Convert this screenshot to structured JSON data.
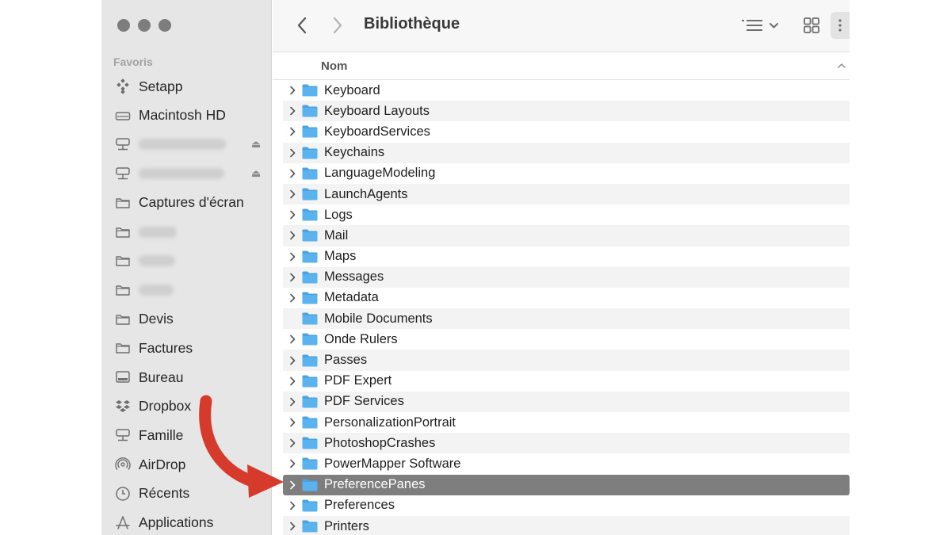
{
  "window": {
    "title": "Bibliothèque"
  },
  "sidebar": {
    "section_label": "Favoris",
    "items": [
      {
        "label": "Setapp",
        "icon": "setapp-icon"
      },
      {
        "label": "Macintosh HD",
        "icon": "hard-drive-icon"
      },
      {
        "label": "",
        "icon": "network-drive-icon",
        "blurred": true,
        "eject": "⏏"
      },
      {
        "label": "",
        "icon": "network-drive-icon",
        "blurred": true,
        "eject": "⏏"
      },
      {
        "label": "Captures d'écran",
        "icon": "folder-icon"
      },
      {
        "label": "",
        "icon": "folder-icon",
        "blurred": true
      },
      {
        "label": "",
        "icon": "folder-icon",
        "blurred": true
      },
      {
        "label": "",
        "icon": "folder-icon",
        "blurred": true
      },
      {
        "label": "Devis",
        "icon": "folder-icon"
      },
      {
        "label": "Factures",
        "icon": "folder-icon"
      },
      {
        "label": "Bureau",
        "icon": "desktop-icon"
      },
      {
        "label": "Dropbox",
        "icon": "dropbox-icon"
      },
      {
        "label": "Famille",
        "icon": "network-drive-icon"
      },
      {
        "label": "AirDrop",
        "icon": "airdrop-icon"
      },
      {
        "label": "Récents",
        "icon": "clock-icon"
      },
      {
        "label": "Applications",
        "icon": "applications-icon"
      }
    ]
  },
  "list": {
    "column_name": "Nom",
    "rows": [
      {
        "name": "Keyboard",
        "expandable": true
      },
      {
        "name": "Keyboard Layouts",
        "expandable": true
      },
      {
        "name": "KeyboardServices",
        "expandable": true
      },
      {
        "name": "Keychains",
        "expandable": true
      },
      {
        "name": "LanguageModeling",
        "expandable": true
      },
      {
        "name": "LaunchAgents",
        "expandable": true
      },
      {
        "name": "Logs",
        "expandable": true
      },
      {
        "name": "Mail",
        "expandable": true
      },
      {
        "name": "Maps",
        "expandable": true
      },
      {
        "name": "Messages",
        "expandable": true
      },
      {
        "name": "Metadata",
        "expandable": true
      },
      {
        "name": "Mobile Documents",
        "expandable": false
      },
      {
        "name": "Onde Rulers",
        "expandable": true
      },
      {
        "name": "Passes",
        "expandable": true
      },
      {
        "name": "PDF Expert",
        "expandable": true
      },
      {
        "name": "PDF Services",
        "expandable": true
      },
      {
        "name": "PersonalizationPortrait",
        "expandable": true
      },
      {
        "name": "PhotoshopCrashes",
        "expandable": true
      },
      {
        "name": "PowerMapper Software",
        "expandable": true
      },
      {
        "name": "PreferencePanes",
        "expandable": true,
        "selected": true
      },
      {
        "name": "Preferences",
        "expandable": true
      },
      {
        "name": "Printers",
        "expandable": true
      }
    ]
  },
  "colors": {
    "folder": "#5ab3ee",
    "folder_tab": "#4aa3e0",
    "selection": "#7e7e7e",
    "annotation_arrow": "#d63a2b"
  }
}
